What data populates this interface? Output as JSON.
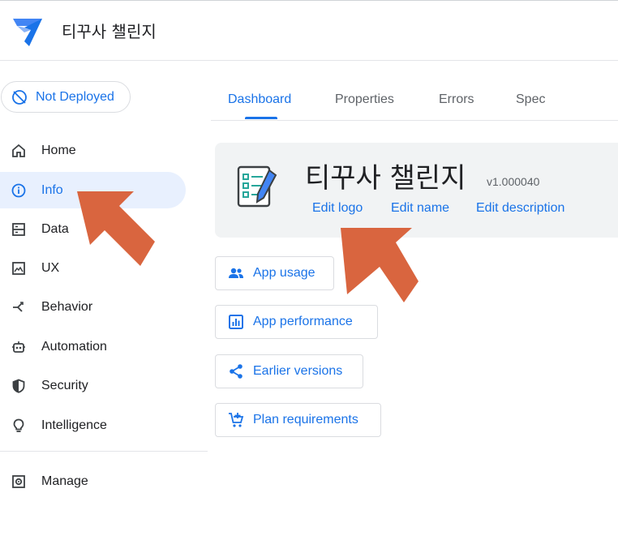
{
  "header": {
    "app_title": "티꾸사 챌린지",
    "logo_icon": "appsheet-logo-icon"
  },
  "deploy": {
    "label": "Not Deployed",
    "icon": "not-deployed-icon"
  },
  "tabs": [
    {
      "label": "Dashboard",
      "active": true
    },
    {
      "label": "Properties"
    },
    {
      "label": "Errors"
    },
    {
      "label": "Spec"
    }
  ],
  "sidebar": {
    "items": [
      {
        "label": "Home",
        "icon": "home-icon"
      },
      {
        "label": "Info",
        "icon": "info-icon",
        "active": true
      },
      {
        "label": "Data",
        "icon": "data-icon"
      },
      {
        "label": "UX",
        "icon": "ux-icon"
      },
      {
        "label": "Behavior",
        "icon": "behavior-icon"
      },
      {
        "label": "Automation",
        "icon": "automation-icon"
      },
      {
        "label": "Security",
        "icon": "shield-icon"
      },
      {
        "label": "Intelligence",
        "icon": "lightbulb-icon"
      },
      {
        "label": "Manage",
        "icon": "manage-icon"
      }
    ]
  },
  "card": {
    "title": "티꾸사 챌린지",
    "version": "v1.000040",
    "links": {
      "edit_logo": "Edit logo",
      "edit_name": "Edit name",
      "edit_description": "Edit description"
    }
  },
  "actions": [
    {
      "label": "App usage",
      "icon": "people-icon"
    },
    {
      "label": "App performance",
      "icon": "chart-icon"
    },
    {
      "label": "Earlier versions",
      "icon": "share-icon"
    },
    {
      "label": "Plan requirements",
      "icon": "cart-icon"
    }
  ],
  "colors": {
    "accent": "#1a73e8",
    "annotation_arrow": "#d9653f",
    "active_nav_bg": "#e8f0fe"
  }
}
